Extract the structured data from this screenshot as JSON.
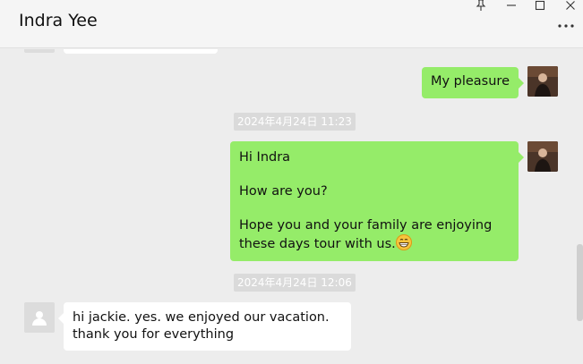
{
  "header": {
    "title": "Indra Yee",
    "controls": [
      "pin-icon",
      "minimize-icon",
      "maximize-icon",
      "close-icon"
    ],
    "more_icon": "more-icon"
  },
  "messages": [
    {
      "sender": "me",
      "text": "My pleasure"
    },
    {
      "type": "timestamp",
      "text": "2024年4月24日 11:23"
    },
    {
      "sender": "me",
      "lines": [
        "Hi Indra",
        "How are you?",
        "Hope you and your family are enjoying these days tour with us."
      ],
      "emoji": "grinning-face-emoji"
    },
    {
      "type": "timestamp",
      "text": "2024年4月24日 12:06"
    },
    {
      "sender": "other",
      "text": "hi jackie. yes. we enjoyed our vacation. thank you for everything"
    }
  ],
  "colors": {
    "my_bubble": "#95ec69",
    "other_bubble": "#ffffff",
    "background": "#ededed",
    "timestamp_bg": "#dadada"
  }
}
